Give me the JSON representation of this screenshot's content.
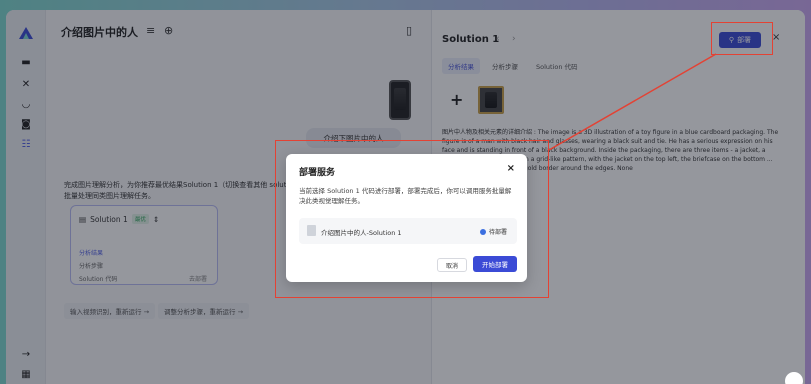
{
  "header": {
    "title": "介绍图片中的人"
  },
  "sidebar": {
    "icons": [
      "logo-icon",
      "folder-icon",
      "tools-icon",
      "cup-icon",
      "lock-icon",
      "new-icon",
      "arrow-right-icon",
      "grid-icon"
    ]
  },
  "main": {
    "bubble": "介绍下图片中的人",
    "answer": "完成图片理解分析，为你推荐最优结果Solution 1（切换查看其他 solution）。批量处理同类图片理解任务。",
    "card": {
      "title": "Solution 1",
      "badge": "最优",
      "rows": [
        "分析结果",
        "分析步骤",
        "Solution 代码"
      ],
      "right_label": "去部署"
    },
    "follow_ups": [
      "输入视频识别，重新运行 →",
      "调整分析步骤，重新运行 →"
    ]
  },
  "right": {
    "title": "Solution 1",
    "nav_prev": "‹",
    "nav_next": "›",
    "deploy_label": "部署",
    "close": "×",
    "tabs": [
      "分析结果",
      "分析步骤",
      "Solution 代码"
    ],
    "plus": "+",
    "description": "图片中人物及相关元素的详细介绍 : The image is a 3D illustration of a toy figure in a blue cardboard packaging. The figure is of a man with black hair and glasses, wearing a black suit and tie. He has a serious expression on his face and is standing in front of a black background. Inside the packaging, there are three items - a jacket, a briefcase, and ... arranged in a grid-like pattern, with the jacket on the top left, the briefcase on the bottom ... right. The packaging has a gold border around the edges. None"
  },
  "modal": {
    "title": "部署服务",
    "close": "×",
    "description": "当前选择 Solution 1 代码进行部署，部署完成后，你可以调用服务批量解决此类视觉理解任务。",
    "service_name": "介绍图片中的人-Solution 1",
    "service_status": "待部署",
    "cancel_label": "取消",
    "start_label": "开始部署"
  },
  "colors": {
    "accent": "#3b4bd6",
    "highlight": "#e34234",
    "status_dot": "#3b6fe0"
  }
}
